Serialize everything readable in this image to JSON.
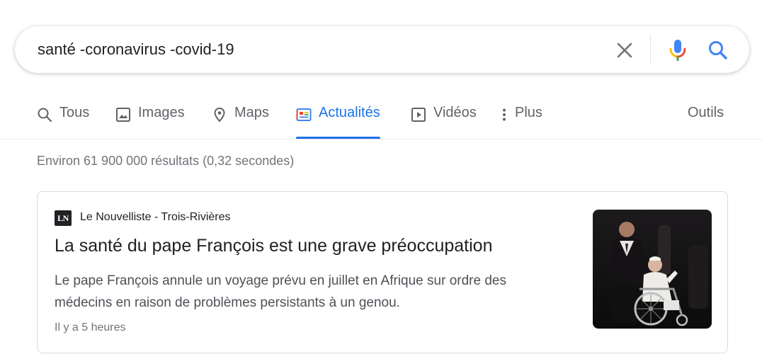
{
  "search": {
    "query": "santé -coronavirus -covid-19"
  },
  "tabs": [
    {
      "label": "Tous",
      "icon": "search-icon"
    },
    {
      "label": "Images",
      "icon": "image-icon"
    },
    {
      "label": "Maps",
      "icon": "map-pin-icon"
    },
    {
      "label": "Actualités",
      "icon": "news-icon",
      "active": true
    },
    {
      "label": "Vidéos",
      "icon": "video-icon"
    },
    {
      "label": "Plus",
      "icon": "more-vert-icon"
    }
  ],
  "tools_label": "Outils",
  "results_stats": "Environ 61 900 000 résultats (0,32 secondes)",
  "news_result": {
    "source_logo_text": "LN",
    "source": "Le Nouvelliste - Trois-Rivières",
    "title": "La santé du pape François est une grave préoccupation",
    "snippet_line1": "Le pape François annule un voyage prévu en juillet en Afrique sur ordre des",
    "snippet_line2": "médecins en raison de problèmes persistants à un genou.",
    "time": "Il y a 5 heures"
  },
  "colors": {
    "accent": "#1a73e8",
    "text_primary": "#202124",
    "text_secondary": "#5f6368",
    "text_snippet": "#4d5156",
    "text_muted": "#70757a",
    "mic_blue": "#4285f4",
    "mic_red": "#ea4335",
    "mic_yellow": "#fbbc04",
    "mic_green": "#34a853"
  }
}
